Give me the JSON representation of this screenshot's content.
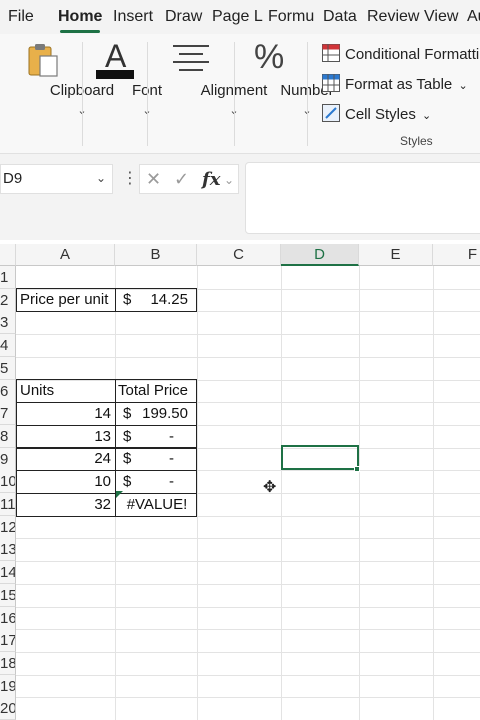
{
  "tabs": [
    "File",
    "Home",
    "Insert",
    "Draw",
    "Page L",
    "Formu",
    "Data",
    "Review",
    "View",
    "Au"
  ],
  "ribbon": {
    "clipboard": "Clipboard",
    "font": "Font",
    "alignment": "Alignment",
    "number": "Number",
    "conditional_formatting": "Conditional Formatting",
    "format_as_table": "Format as Table",
    "cell_styles": "Cell Styles",
    "styles_group": "Styles",
    "font_icon_letter": "A",
    "number_icon_symbol": "%"
  },
  "formula_bar": {
    "name_box": "D9",
    "formula": ""
  },
  "columns": [
    "A",
    "B",
    "C",
    "D",
    "E",
    "F"
  ],
  "rows": [
    "1",
    "2",
    "3",
    "4",
    "5",
    "6",
    "7",
    "8",
    "9",
    "10",
    "11",
    "12",
    "13",
    "14",
    "15",
    "16",
    "17",
    "18",
    "19",
    "20"
  ],
  "cells": {
    "a2": "Price per unit",
    "b2_currency": "$",
    "b2_value": "14.25",
    "a6": "Units",
    "b6": "Total Price",
    "units": [
      "14",
      "13",
      "24",
      "10",
      "32"
    ],
    "totals": [
      {
        "currency": "$",
        "value": "199.50"
      },
      {
        "currency": "$",
        "value": "-"
      },
      {
        "currency": "$",
        "value": "-"
      },
      {
        "currency": "$",
        "value": "-"
      },
      {
        "currency": "",
        "value": "#VALUE!"
      }
    ]
  },
  "selected_cell": "D9",
  "colors": {
    "accent": "#1e7145",
    "ribbon_bg": "#f8f8f8",
    "tab_bar_bg": "#f3f3f3"
  }
}
